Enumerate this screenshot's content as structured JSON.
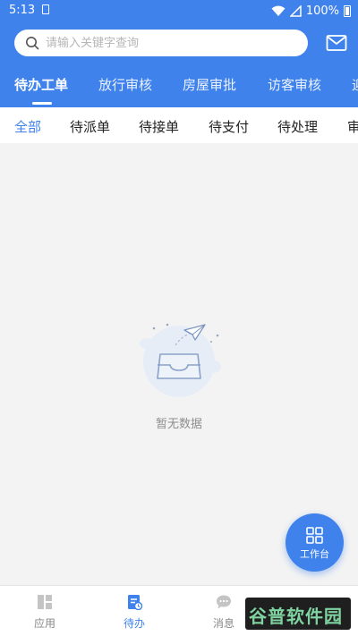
{
  "status_bar": {
    "time": "5:13",
    "battery": "100%"
  },
  "search": {
    "placeholder": "请输入关键字查询"
  },
  "main_tabs": [
    {
      "label": "待办工单",
      "active": true
    },
    {
      "label": "放行审核",
      "active": false
    },
    {
      "label": "房屋审批",
      "active": false
    },
    {
      "label": "访客审核",
      "active": false
    },
    {
      "label": "迎",
      "active": false
    }
  ],
  "sub_tabs": [
    {
      "label": "全部",
      "active": true
    },
    {
      "label": "待派单",
      "active": false
    },
    {
      "label": "待接单",
      "active": false
    },
    {
      "label": "待支付",
      "active": false
    },
    {
      "label": "待处理",
      "active": false
    },
    {
      "label": "审",
      "active": false
    }
  ],
  "empty_state": {
    "text": "暂无数据"
  },
  "fab": {
    "label": "工作台"
  },
  "bottom_nav": [
    {
      "label": "应用",
      "icon": "apps-icon",
      "active": false
    },
    {
      "label": "待办",
      "icon": "todo-icon",
      "active": true
    },
    {
      "label": "消息",
      "icon": "message-icon",
      "active": false
    }
  ],
  "watermark": {
    "text": "谷普软件园"
  },
  "colors": {
    "primary": "#3f82ec",
    "background": "#f3f3f3",
    "text_muted": "#8e8e8e"
  }
}
